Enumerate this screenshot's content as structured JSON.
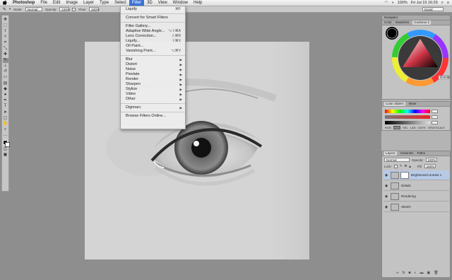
{
  "menubar": {
    "apple": "",
    "app_name": "Photoshop",
    "items": [
      "File",
      "Edit",
      "Image",
      "Layer",
      "Type",
      "Select",
      "Filter",
      "3D",
      "View",
      "Window",
      "Help"
    ],
    "active_item": "Filter",
    "clock": "Fri Jul 15  16:29",
    "zoom": "100%",
    "user": "David"
  },
  "options_bar": {
    "mode_label": "Mode:",
    "mode_value": "Normal",
    "opacity_label": "Opacity:",
    "opacity_value": "100%",
    "flow_label": "Flow:",
    "flow_value": "100%",
    "workspace": "David"
  },
  "filter_menu": {
    "items": [
      {
        "label": "Liquify",
        "shortcut": "⌘F",
        "submenu": false
      },
      {
        "sep": true
      },
      {
        "label": "Convert for Smart Filters",
        "shortcut": "",
        "submenu": false
      },
      {
        "sep": true
      },
      {
        "label": "Filter Gallery...",
        "shortcut": "",
        "submenu": false
      },
      {
        "label": "Adaptive Wide Angle...",
        "shortcut": "⌥⇧⌘A",
        "submenu": false
      },
      {
        "label": "Lens Correction...",
        "shortcut": "⇧⌘R",
        "submenu": false
      },
      {
        "label": "Liquify...",
        "shortcut": "⇧⌘X",
        "submenu": false
      },
      {
        "label": "Oil Paint...",
        "shortcut": "",
        "submenu": false
      },
      {
        "label": "Vanishing Point...",
        "shortcut": "⌥⌘V",
        "submenu": false
      },
      {
        "sep": true
      },
      {
        "label": "Blur",
        "shortcut": "",
        "submenu": true
      },
      {
        "label": "Distort",
        "shortcut": "",
        "submenu": true
      },
      {
        "label": "Noise",
        "shortcut": "",
        "submenu": true
      },
      {
        "label": "Pixelate",
        "shortcut": "",
        "submenu": true
      },
      {
        "label": "Render",
        "shortcut": "",
        "submenu": true
      },
      {
        "label": "Sharpen",
        "shortcut": "",
        "submenu": true
      },
      {
        "label": "Stylize",
        "shortcut": "",
        "submenu": true
      },
      {
        "label": "Video",
        "shortcut": "",
        "submenu": true
      },
      {
        "label": "Other",
        "shortcut": "",
        "submenu": true
      },
      {
        "sep": true
      },
      {
        "label": "Digimarc",
        "shortcut": "",
        "submenu": true
      },
      {
        "sep": true
      },
      {
        "label": "Browse Filters Online...",
        "shortcut": "",
        "submenu": false
      }
    ]
  },
  "toolbar": {
    "tools": [
      "move-tool",
      "marquee-tool",
      "lasso-tool",
      "quick-select-tool",
      "crop-tool",
      "eyedropper-tool",
      "healing-tool",
      "brush-tool",
      "clone-stamp-tool",
      "history-brush-tool",
      "eraser-tool",
      "gradient-tool",
      "blur-tool",
      "dodge-tool",
      "pen-tool",
      "type-tool",
      "path-select-tool",
      "shape-tool",
      "hand-tool",
      "zoom-tool"
    ],
    "selected": "brush-tool"
  },
  "panels": {
    "navigator_tabs": [
      "Navigator"
    ],
    "color_tabs": [
      "Color",
      "Swatches",
      "Coolorus 2"
    ],
    "color_tab_active": "Coolorus 2",
    "hex_value": "666666",
    "sliders_tabs": [
      "Color Sliders",
      "Mixer"
    ],
    "sliders_tab_active": "Color Sliders",
    "slider_modes": [
      "RGB",
      "HSB",
      "HSL",
      "LAB",
      "CMYK",
      "GRAYSCALE"
    ],
    "slider_mode_active": "HSB",
    "layers_tabs": [
      "Layers",
      "Channels",
      "Paths"
    ],
    "layers_tab_active": "Layers",
    "blend_mode": "Normal",
    "opacity_label": "Opacity:",
    "opacity_value": "100%",
    "lock_label": "Lock:",
    "fill_label": "Fill:",
    "fill_value": "100%",
    "layers": [
      {
        "name": "Brightness/Contrast 1",
        "selected": true,
        "adjustment": true
      },
      {
        "name": "Details",
        "selected": false,
        "adjustment": false
      },
      {
        "name": "Rendering",
        "selected": false,
        "adjustment": false
      },
      {
        "name": "Sketch",
        "selected": false,
        "adjustment": false
      }
    ]
  },
  "colors": {
    "menu_highlight": "#3a74d8",
    "layer_selected": "#b7cae6",
    "background": "#8e8e8e"
  }
}
